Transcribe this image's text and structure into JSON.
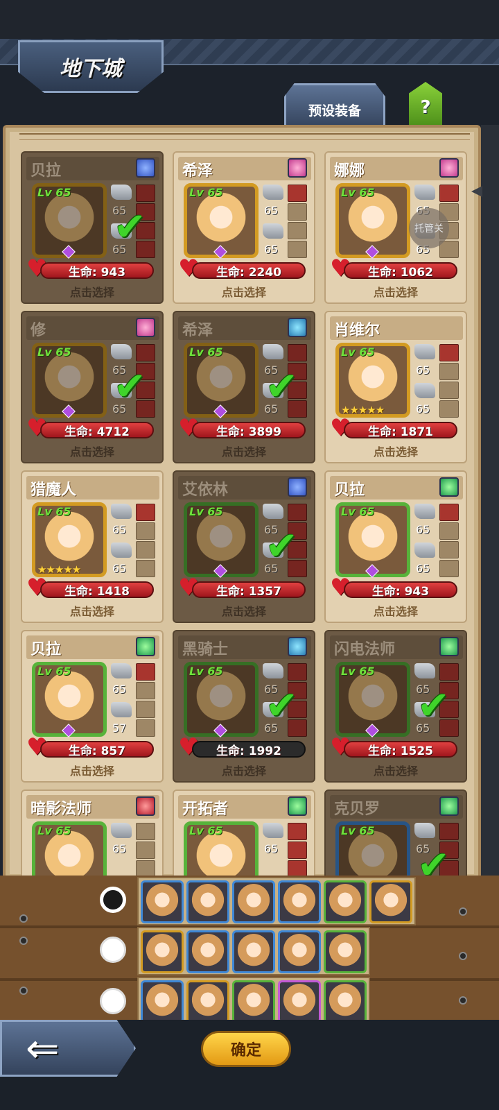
{
  "header": {
    "title": "地下城",
    "preset_label": "预设装备",
    "help_label": "?"
  },
  "auto_label": "托管关",
  "cards": [
    {
      "name": "贝拉",
      "lv": "Lv 65",
      "eq1": "65",
      "eq2": "65",
      "hp": "生命: 943",
      "select": "点击选择",
      "gem": "blue"
    },
    {
      "name": "希泽",
      "lv": "Lv 65",
      "eq1": "65",
      "eq2": "65",
      "hp": "生命: 2240",
      "select": "点击选择",
      "gem": "pink"
    },
    {
      "name": "娜娜",
      "lv": "Lv 65",
      "eq1": "65",
      "eq2": "65",
      "hp": "生命: 1062",
      "select": "点击选择",
      "gem": "pink"
    },
    {
      "name": "修",
      "lv": "Lv 65",
      "eq1": "65",
      "eq2": "65",
      "hp": "生命: 4712",
      "select": "点击选择",
      "gem": "pink"
    },
    {
      "name": "希泽",
      "lv": "Lv 65",
      "eq1": "65",
      "eq2": "65",
      "hp": "生命: 3899",
      "select": "点击选择",
      "gem": "teal"
    },
    {
      "name": "肖维尔",
      "lv": "Lv 65",
      "eq1": "65",
      "eq2": "65",
      "hp": "生命: 1871",
      "select": "点击选择",
      "gem": "none"
    },
    {
      "name": "猎魔人",
      "lv": "Lv 65",
      "eq1": "65",
      "eq2": "65",
      "hp": "生命: 1418",
      "select": "点击选择",
      "gem": "none"
    },
    {
      "name": "艾依林",
      "lv": "Lv 65",
      "eq1": "65",
      "eq2": "65",
      "hp": "生命: 1357",
      "select": "点击选择",
      "gem": "blue"
    },
    {
      "name": "贝拉",
      "lv": "Lv 65",
      "eq1": "65",
      "eq2": "65",
      "hp": "生命: 943",
      "select": "点击选择",
      "gem": "green"
    },
    {
      "name": "贝拉",
      "lv": "Lv 65",
      "eq1": "65",
      "eq2": "57",
      "hp": "生命: 857",
      "select": "点击选择",
      "gem": "green"
    },
    {
      "name": "黑骑士",
      "lv": "Lv 65",
      "eq1": "65",
      "eq2": "65",
      "hp": "生命: 1992",
      "select": "点击选择",
      "gem": "teal"
    },
    {
      "name": "闪电法师",
      "lv": "Lv 65",
      "eq1": "65",
      "eq2": "65",
      "hp": "生命: 1525",
      "select": "点击选择",
      "gem": "green"
    },
    {
      "name": "暗影法师",
      "lv": "Lv 65",
      "eq1": "65",
      "eq2": "",
      "hp": "",
      "select": "",
      "gem": "red"
    },
    {
      "name": "开拓者",
      "lv": "Lv 65",
      "eq1": "65",
      "eq2": "",
      "hp": "",
      "select": "",
      "gem": "green"
    },
    {
      "name": "克贝罗",
      "lv": "Lv 65",
      "eq1": "65",
      "eq2": "",
      "hp": "",
      "select": "",
      "gem": "green"
    }
  ],
  "colors": {
    "hp_bar": "#c81f28",
    "check": "#3fd42a",
    "parchment": "#d8c4a0"
  },
  "footer": {
    "confirm_label": "确定",
    "back_icon": "left-arrow-icon"
  }
}
